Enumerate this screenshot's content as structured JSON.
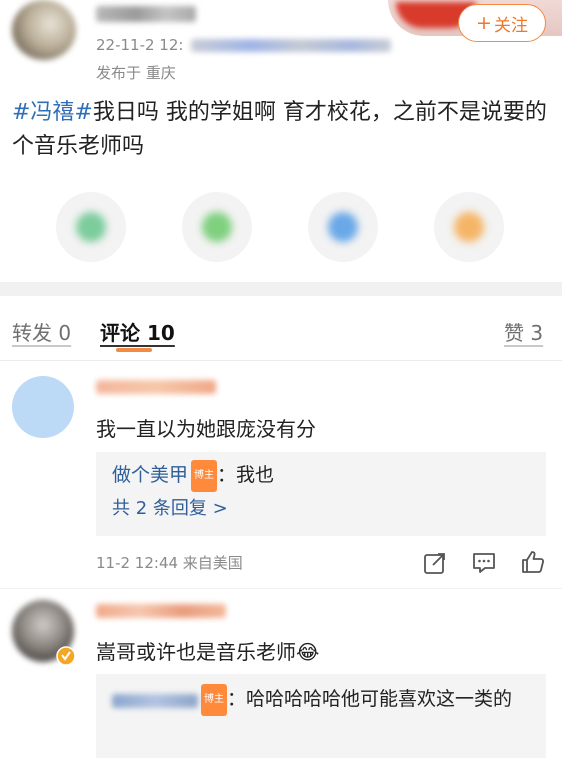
{
  "post": {
    "follow_label": "关注",
    "follow_plus": "+",
    "date_prefix": "22-11-2 12:",
    "location": "发布于 重庆",
    "hashtag": "#冯禧#",
    "body": "我日吗 我的学姐啊 育才校花，之前不是说要的个音乐老师吗"
  },
  "share": {
    "items": [
      {
        "name": "wechat-share",
        "color": "#7ccc9c"
      },
      {
        "name": "moments-share",
        "color": "#7fd07f"
      },
      {
        "name": "qq-share",
        "color": "#6aa8e8"
      },
      {
        "name": "qzone-share",
        "color": "#f5b567"
      }
    ]
  },
  "tabs": {
    "repost": "转发 0",
    "comments": "评论 10",
    "likes": "赞 3"
  },
  "comments": [
    {
      "text": "我一直以为她跟庞没有分",
      "reply_author": "做个美甲",
      "reply_badge": "博主",
      "reply_text": "：我也",
      "more_replies": "共 2 条回复 >",
      "meta": "11-2 12:44  来自美国"
    },
    {
      "text": "嵩哥或许也是音乐老师😂",
      "reply_badge": "博主",
      "reply_text": "：哈哈哈哈哈他可能喜欢这一类的"
    }
  ],
  "colors": {
    "accent": "#f08a45",
    "link": "#2f6fb7"
  }
}
